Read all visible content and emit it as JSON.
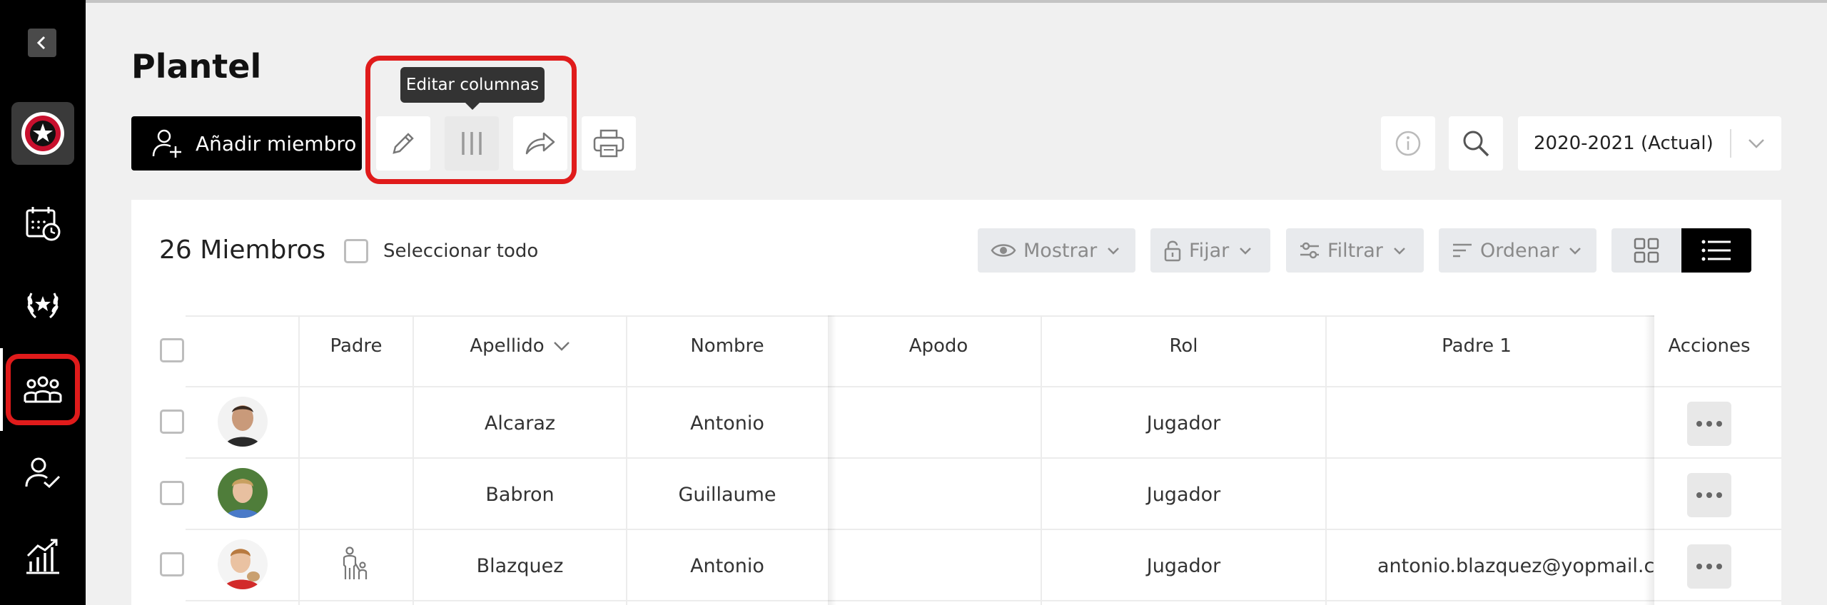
{
  "page": {
    "title": "Plantel",
    "add_member_label": "Añadir miembro",
    "tooltip": "Editar columnas",
    "season": "2020-2021 (Actual)"
  },
  "sidebar": {
    "items": [
      {
        "icon": "calendar-clock-icon"
      },
      {
        "icon": "laurel-icon"
      },
      {
        "icon": "team-icon",
        "active": true
      },
      {
        "icon": "user-check-icon"
      },
      {
        "icon": "stats-chart-icon"
      }
    ]
  },
  "panel": {
    "members_count": "26 Miembros",
    "select_all": "Seleccionar todo",
    "filters": {
      "show": "Mostrar",
      "pin": "Fijar",
      "filter": "Filtrar",
      "sort": "Ordenar"
    }
  },
  "table": {
    "columns": {
      "parent": "Padre",
      "lastname": "Apellido",
      "firstname": "Nombre",
      "nickname": "Apodo",
      "role": "Rol",
      "parent1": "Padre 1",
      "actions": "Acciones"
    },
    "rows": [
      {
        "lastname": "Alcaraz",
        "firstname": "Antonio",
        "nickname": "",
        "role": "Jugador",
        "parent1": "",
        "has_parent": false
      },
      {
        "lastname": "Babron",
        "firstname": "Guillaume",
        "nickname": "",
        "role": "Jugador",
        "parent1": "",
        "has_parent": false
      },
      {
        "lastname": "Blazquez",
        "firstname": "Antonio",
        "nickname": "",
        "role": "Jugador",
        "parent1": "antonio.blazquez@yopmail.com",
        "has_parent": true
      }
    ]
  },
  "colors": {
    "highlight": "#e01b1b",
    "sidebar_bg": "#000000",
    "primary_button": "#000000"
  }
}
